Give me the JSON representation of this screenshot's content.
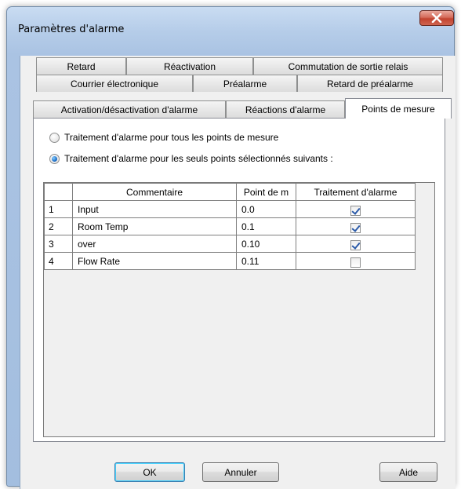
{
  "window": {
    "title": "Paramètres d'alarme"
  },
  "tabs": {
    "row1": [
      "Retard",
      "Réactivation",
      "Commutation de sortie relais"
    ],
    "row2": [
      "Courrier électronique",
      "Préalarme",
      "Retard de préalarme"
    ],
    "row3": [
      "Activation/désactivation d'alarme",
      "Réactions d'alarme",
      "Points de mesure"
    ]
  },
  "options": {
    "all_points": "Traitement d'alarme pour tous les points de mesure",
    "selected_points": "Traitement d'alarme pour les seuls points sélectionnés suivants :",
    "selected": "selected_points"
  },
  "table": {
    "headers": [
      "Commentaire",
      "Point de m",
      "Traitement d'alarme"
    ],
    "rows": [
      {
        "num": "1",
        "comment": "Input",
        "point": "0.0",
        "alarm": true
      },
      {
        "num": "2",
        "comment": "Room Temp",
        "point": "0.1",
        "alarm": true
      },
      {
        "num": "3",
        "comment": "over",
        "point": "0.10",
        "alarm": true
      },
      {
        "num": "4",
        "comment": "Flow Rate",
        "point": "0.11",
        "alarm": false
      }
    ]
  },
  "buttons": {
    "ok": "OK",
    "cancel": "Annuler",
    "help": "Aide"
  },
  "colors": {
    "accent": "#1f70c8",
    "close_button": "#c7412f"
  }
}
